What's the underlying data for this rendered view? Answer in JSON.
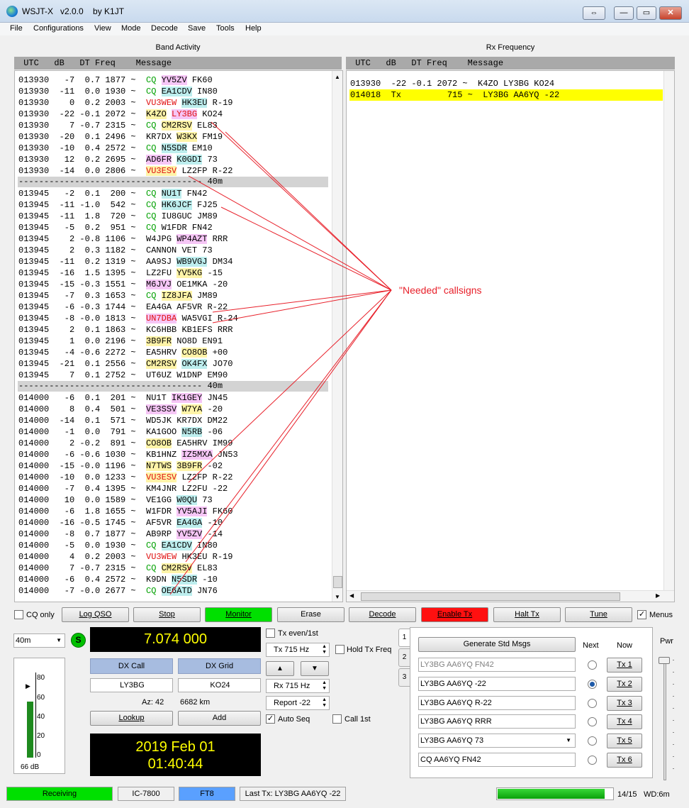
{
  "window": {
    "title": "WSJT-X   v2.0.0    by K1JT",
    "min": "—",
    "max": "▭",
    "close": "✕",
    "pin": "⇔"
  },
  "menu": [
    "File",
    "Configurations",
    "View",
    "Mode",
    "Decode",
    "Save",
    "Tools",
    "Help"
  ],
  "band_activity": {
    "title": "Band Activity",
    "header": " UTC   dB   DT Freq    Message",
    "lines": [
      {
        "pre": "013930   -7  0.7 1877 ~  ",
        "parts": [
          [
            "CQ",
            "cq",
            ""
          ],
          [
            " ",
            ""
          ],
          [
            "YV5ZV",
            "",
            "#f6c6f6"
          ],
          [
            " FK60",
            ""
          ]
        ]
      },
      {
        "pre": "013930  -11  0.0 1930 ~  ",
        "parts": [
          [
            "CQ",
            "cq",
            ""
          ],
          [
            " ",
            ""
          ],
          [
            "EA1CDV",
            "",
            "#bdeeee"
          ],
          [
            " IN80",
            ""
          ]
        ]
      },
      {
        "pre": "013930    0  0.2 2003 ~  ",
        "parts": [
          [
            "VU3WEW",
            "red",
            ""
          ],
          [
            " ",
            ""
          ],
          [
            "HK3EU",
            "",
            "#bdeeee"
          ],
          [
            " R-19",
            ""
          ]
        ]
      },
      {
        "pre": "013930  -22 -0.1 2072 ~  ",
        "parts": [
          [
            "K4ZO",
            "",
            "#fff4a8"
          ],
          [
            " ",
            ""
          ],
          [
            "LY3BG",
            "red",
            "#f6c6f6"
          ],
          [
            " KO24",
            ""
          ]
        ]
      },
      {
        "pre": "013930    7 -0.7 2315 ~  ",
        "parts": [
          [
            "CQ",
            "cq",
            ""
          ],
          [
            " ",
            ""
          ],
          [
            "CM2RSV",
            "",
            "#fff4a8"
          ],
          [
            " EL83",
            ""
          ]
        ]
      },
      {
        "pre": "013930  -20  0.1 2496 ~  ",
        "parts": [
          [
            "KR7DX ",
            ""
          ],
          [
            "W3KX",
            "",
            "#fff4a8"
          ],
          [
            " FM19",
            ""
          ]
        ]
      },
      {
        "pre": "013930  -10  0.4 2572 ~  ",
        "parts": [
          [
            "CQ",
            "cq",
            ""
          ],
          [
            " ",
            ""
          ],
          [
            "N5SDR",
            "",
            "#bdeeee"
          ],
          [
            " EM10",
            ""
          ]
        ]
      },
      {
        "pre": "013930   12  0.2 2695 ~  ",
        "parts": [
          [
            "AD6FR",
            "",
            "#f6c6f6"
          ],
          [
            " ",
            ""
          ],
          [
            "K0GDI",
            "",
            "#bdeeee"
          ],
          [
            " 73",
            ""
          ]
        ]
      },
      {
        "pre": "013930  -14  0.0 2806 ~  ",
        "parts": [
          [
            "VU3ESV",
            "red",
            "#fff4a8"
          ],
          [
            " LZ2FP R-22",
            ""
          ]
        ]
      },
      {
        "sep": "------------------------------------ 40m"
      },
      {
        "pre": "013945   -2  0.1  200 ~  ",
        "parts": [
          [
            "CQ",
            "cq",
            ""
          ],
          [
            " ",
            ""
          ],
          [
            "NU1T",
            "",
            "#bdeeee"
          ],
          [
            " FN42",
            ""
          ]
        ]
      },
      {
        "pre": "013945  -11 -1.0  542 ~  ",
        "parts": [
          [
            "CQ",
            "cq",
            ""
          ],
          [
            " ",
            ""
          ],
          [
            "HK6JCF",
            "",
            "#bdeeee"
          ],
          [
            " FJ25",
            ""
          ]
        ]
      },
      {
        "pre": "013945  -11  1.8  720 ~  ",
        "parts": [
          [
            "CQ",
            "cq",
            ""
          ],
          [
            " IU8GUC JM89",
            ""
          ]
        ]
      },
      {
        "pre": "013945   -5  0.2  951 ~  ",
        "parts": [
          [
            "CQ",
            "cq",
            ""
          ],
          [
            " W1FDR FN42",
            ""
          ]
        ]
      },
      {
        "pre": "013945    2 -0.8 1106 ~  ",
        "parts": [
          [
            "W4JPG ",
            ""
          ],
          [
            "WP4AZT",
            "",
            "#f6c6f6"
          ],
          [
            " RRR",
            ""
          ]
        ]
      },
      {
        "pre": "013945    2  0.3 1182 ~  ",
        "parts": [
          [
            "CANNON VET 73",
            ""
          ]
        ]
      },
      {
        "pre": "013945  -11  0.2 1319 ~  ",
        "parts": [
          [
            "AA9SJ ",
            ""
          ],
          [
            "WB9VGJ",
            "",
            "#bdeeee"
          ],
          [
            " DM34",
            ""
          ]
        ]
      },
      {
        "pre": "013945  -16  1.5 1395 ~  ",
        "parts": [
          [
            "LZ2FU ",
            ""
          ],
          [
            "YV5KG",
            "",
            "#fff4a8"
          ],
          [
            " -15",
            ""
          ]
        ]
      },
      {
        "pre": "013945  -15 -0.3 1551 ~  ",
        "parts": [
          [
            "M6JVJ",
            "",
            "#f6c6f6"
          ],
          [
            " OE1MKA -20",
            ""
          ]
        ]
      },
      {
        "pre": "013945   -7  0.3 1653 ~  ",
        "parts": [
          [
            "CQ",
            "cq",
            ""
          ],
          [
            " ",
            ""
          ],
          [
            "IZ8JFA",
            "",
            "#fff4a8"
          ],
          [
            " JM89",
            ""
          ]
        ]
      },
      {
        "pre": "013945   -6 -0.3 1744 ~  ",
        "parts": [
          [
            "EA4GA AF5VR R-22",
            ""
          ]
        ]
      },
      {
        "pre": "013945   -8 -0.0 1813 ~  ",
        "parts": [
          [
            "UN7DBA",
            "red",
            "#f6c6f6"
          ],
          [
            " WA5VGI R-24",
            ""
          ]
        ]
      },
      {
        "pre": "013945    2  0.1 1863 ~  ",
        "parts": [
          [
            "KC6HBB KB1EFS RRR",
            ""
          ]
        ]
      },
      {
        "pre": "013945    1  0.0 2196 ~  ",
        "parts": [
          [
            "3B9FR",
            "",
            "#fff4a8"
          ],
          [
            " NO8D EN91",
            ""
          ]
        ]
      },
      {
        "pre": "013945   -4 -0.6 2272 ~  ",
        "parts": [
          [
            "EA5HRV ",
            ""
          ],
          [
            "CO8OB",
            "",
            "#fff4a8"
          ],
          [
            " +00",
            ""
          ]
        ]
      },
      {
        "pre": "013945  -21  0.1 2556 ~  ",
        "parts": [
          [
            "CM2RSV",
            "",
            "#fff4a8"
          ],
          [
            " ",
            ""
          ],
          [
            "OK4FX",
            "",
            "#bdeeee"
          ],
          [
            " JO70",
            ""
          ]
        ]
      },
      {
        "pre": "013945    7  0.1 2752 ~  ",
        "parts": [
          [
            "UT6UZ W1DNP EM90",
            ""
          ]
        ]
      },
      {
        "sep": "------------------------------------ 40m"
      },
      {
        "pre": "014000   -6  0.1  201 ~  ",
        "parts": [
          [
            "NU1T ",
            ""
          ],
          [
            "IK1GEY",
            "",
            "#f6c6f6"
          ],
          [
            " JN45",
            ""
          ]
        ]
      },
      {
        "pre": "014000    8  0.4  501 ~  ",
        "parts": [
          [
            "VE3SSV",
            "",
            "#f6c6f6"
          ],
          [
            " ",
            ""
          ],
          [
            "W7YA",
            "",
            "#fff4a8"
          ],
          [
            " -20",
            ""
          ]
        ]
      },
      {
        "pre": "014000  -14  0.1  571 ~  ",
        "parts": [
          [
            "WD5JK KR7DX DM22",
            ""
          ]
        ]
      },
      {
        "pre": "014000   -1  0.0  791 ~  ",
        "parts": [
          [
            "KA1GOO ",
            ""
          ],
          [
            "N5RB",
            "",
            "#bdeeee"
          ],
          [
            " -06",
            ""
          ]
        ]
      },
      {
        "pre": "014000    2 -0.2  891 ~  ",
        "parts": [
          [
            "CO8OB",
            "",
            "#fff4a8"
          ],
          [
            " EA5HRV IM99",
            ""
          ]
        ]
      },
      {
        "pre": "014000   -6 -0.6 1030 ~  ",
        "parts": [
          [
            "KB1HNZ ",
            ""
          ],
          [
            "IZ5MXA",
            "",
            "#f6c6f6"
          ],
          [
            " JN53",
            ""
          ]
        ]
      },
      {
        "pre": "014000  -15 -0.0 1196 ~  ",
        "parts": [
          [
            "N7TWS",
            "",
            "#fff4a8"
          ],
          [
            " ",
            ""
          ],
          [
            "3B9FR",
            "",
            "#fff4a8"
          ],
          [
            " -02",
            ""
          ]
        ]
      },
      {
        "pre": "014000  -10  0.0 1233 ~  ",
        "parts": [
          [
            "VU3ESV",
            "red",
            "#fff4a8"
          ],
          [
            " LZ2FP R-22",
            ""
          ]
        ]
      },
      {
        "pre": "014000   -7  0.4 1395 ~  ",
        "parts": [
          [
            "KM4JNR LZ2FU -22",
            ""
          ]
        ]
      },
      {
        "pre": "014000   10  0.0 1589 ~  ",
        "parts": [
          [
            "VE1GG ",
            ""
          ],
          [
            "W0QU",
            "",
            "#bdeeee"
          ],
          [
            " 73",
            ""
          ]
        ]
      },
      {
        "pre": "014000   -6  1.8 1655 ~  ",
        "parts": [
          [
            "W1FDR ",
            ""
          ],
          [
            "YV5AJI",
            "",
            "#f6c6f6"
          ],
          [
            " FK60",
            ""
          ]
        ]
      },
      {
        "pre": "014000  -16 -0.5 1745 ~  ",
        "parts": [
          [
            "AF5VR ",
            ""
          ],
          [
            "EA4GA",
            "",
            "#bdeeee"
          ],
          [
            " -10",
            ""
          ]
        ]
      },
      {
        "pre": "014000   -8  0.7 1877 ~  ",
        "parts": [
          [
            "AB9RP ",
            ""
          ],
          [
            "YV5ZV",
            "",
            "#f6c6f6"
          ],
          [
            " -14",
            ""
          ]
        ]
      },
      {
        "pre": "014000   -5  0.0 1930 ~  ",
        "parts": [
          [
            "CQ",
            "cq",
            ""
          ],
          [
            " ",
            ""
          ],
          [
            "EA1CDV",
            "",
            "#bdeeee"
          ],
          [
            " IN80",
            ""
          ]
        ]
      },
      {
        "pre": "014000    4  0.2 2003 ~  ",
        "parts": [
          [
            "VU3WEW",
            "red",
            ""
          ],
          [
            " HK3EU R-19",
            ""
          ]
        ]
      },
      {
        "pre": "014000    7 -0.7 2315 ~  ",
        "parts": [
          [
            "CQ",
            "cq",
            ""
          ],
          [
            " ",
            ""
          ],
          [
            "CM2RSV",
            "",
            "#fff4a8"
          ],
          [
            " EL83",
            ""
          ]
        ]
      },
      {
        "pre": "014000   -6  0.4 2572 ~  ",
        "parts": [
          [
            "K9DN ",
            ""
          ],
          [
            "N5SDR",
            "",
            "#bdeeee"
          ],
          [
            " -10",
            ""
          ]
        ]
      },
      {
        "pre": "014000   -7 -0.0 2677 ~  ",
        "parts": [
          [
            "CQ",
            "cq",
            ""
          ],
          [
            " ",
            ""
          ],
          [
            "OE6ATD",
            "",
            "#bdeeee"
          ],
          [
            " JN76",
            ""
          ]
        ]
      }
    ]
  },
  "rx_frequency": {
    "title": "Rx Frequency",
    "header": " UTC   dB   DT Freq    Message",
    "lines": [
      {
        "text": "013930  -22 -0.1 2072 ~  K4ZO LY3BG KO24",
        "highlight": false
      },
      {
        "text": "014018  Tx         715 ~  LY3BG AA6YQ -22",
        "highlight": true
      }
    ]
  },
  "annotation": "\"Needed\" callsigns",
  "controls": {
    "cq_only": "CQ only",
    "log_qso": "Log QSO",
    "stop": "Stop",
    "monitor": "Monitor",
    "erase": "Erase",
    "decode": "Decode",
    "enable_tx": "Enable Tx",
    "halt_tx": "Halt Tx",
    "tune": "Tune",
    "menus": "Menus"
  },
  "band": "40m",
  "frequency": "7.074 000",
  "dx_call_label": "DX Call",
  "dx_grid_label": "DX Grid",
  "dx_call": "LY3BG",
  "dx_grid": "KO24",
  "az": "Az: 42",
  "dist": "6682 km",
  "lookup": "Lookup",
  "add": "Add",
  "date": "2019 Feb 01",
  "time": "01:40:44",
  "meter": {
    "ticks": [
      "80",
      "60",
      "40",
      "20",
      "0"
    ],
    "db": "66 dB",
    "level_pct": 66
  },
  "tx_even": "Tx even/1st",
  "tx_hz": "Tx  715 Hz",
  "hold_tx": "Hold Tx Freq",
  "rx_hz": "Rx  715 Hz",
  "report": "Report -22",
  "auto_seq": "Auto Seq",
  "call_1st": "Call 1st",
  "gen_std": "Generate Std Msgs",
  "next": "Next",
  "now": "Now",
  "tabs": [
    "1",
    "2",
    "3"
  ],
  "tx_msgs": [
    "LY3BG AA6YQ FN42",
    "LY3BG AA6YQ -22",
    "LY3BG AA6YQ R-22",
    "LY3BG AA6YQ RRR",
    "LY3BG AA6YQ 73",
    "CQ AA6YQ FN42"
  ],
  "tx_btns": [
    "Tx 1",
    "Tx 2",
    "Tx 3",
    "Tx 4",
    "Tx 5",
    "Tx 6"
  ],
  "pwr": "Pwr",
  "status": {
    "receiving": "Receiving",
    "rig": "IC-7800",
    "mode": "FT8",
    "last_tx": "Last Tx: LY3BG AA6YQ -22",
    "progress": "14/15",
    "wd": "WD:6m",
    "progress_frac": 0.93
  },
  "colors": {
    "monitor": "#00e000",
    "enable_tx": "#ff1010",
    "status_green": "#00e000",
    "mode_blue": "#5aa0ff",
    "highlight": "#ffff00",
    "cq_green": "#00a000"
  }
}
